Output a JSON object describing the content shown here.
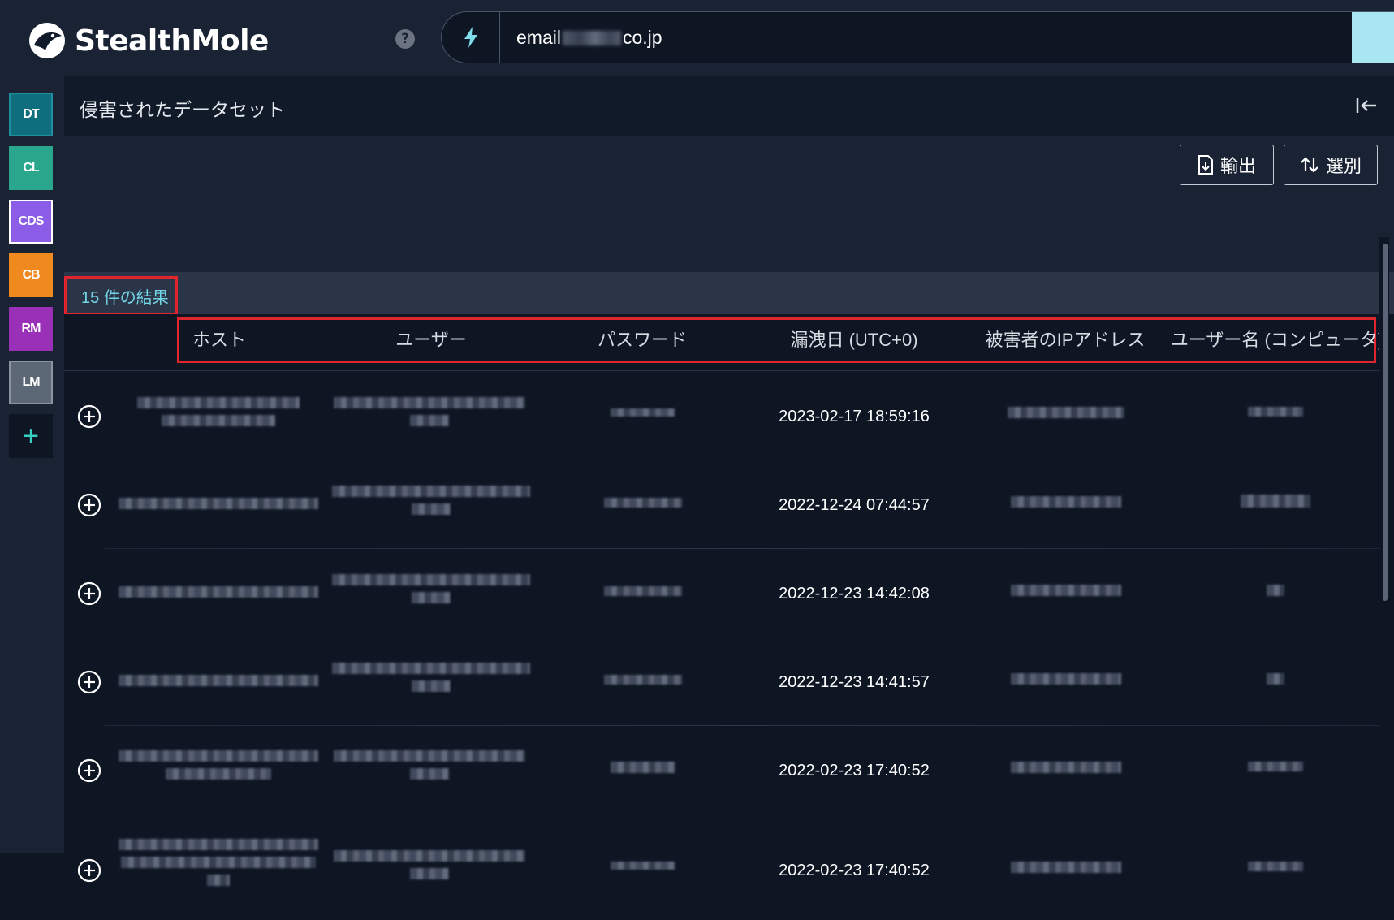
{
  "app": {
    "name": "StealthMole"
  },
  "search": {
    "value_prefix": "email",
    "value_suffix": "co.jp"
  },
  "sidebar": {
    "items": [
      {
        "label": "DT",
        "color": "#0f6e7d"
      },
      {
        "label": "CL",
        "color": "#2aa68c"
      },
      {
        "label": "CDS",
        "color": "#8b5ce6"
      },
      {
        "label": "CB",
        "color": "#f08a1e"
      },
      {
        "label": "RM",
        "color": "#9b30b8"
      },
      {
        "label": "LM",
        "color": "#5d6877"
      }
    ],
    "add_label": "+"
  },
  "panel": {
    "title": "侵害されたデータセット",
    "export_label": "輸出",
    "sort_label": "選別",
    "results": "15 件の結果"
  },
  "table": {
    "columns": [
      "ホスト",
      "ユーザー",
      "パスワード",
      "漏洩日 (UTC+0)",
      "被害者のIPアドレス",
      "ユーザー名 (コンピュータ)"
    ],
    "rows": [
      {
        "date": "2023-02-17 18:59:16"
      },
      {
        "date": "2022-12-24 07:44:57"
      },
      {
        "date": "2022-12-23 14:42:08"
      },
      {
        "date": "2022-12-23 14:41:57"
      },
      {
        "date": "2022-02-23 17:40:52"
      },
      {
        "date": "2022-02-23 17:40:52"
      }
    ]
  },
  "colors": {
    "accent_cyan": "#72d6e6",
    "highlight_red": "#e0252e",
    "background": "#0e1523"
  }
}
